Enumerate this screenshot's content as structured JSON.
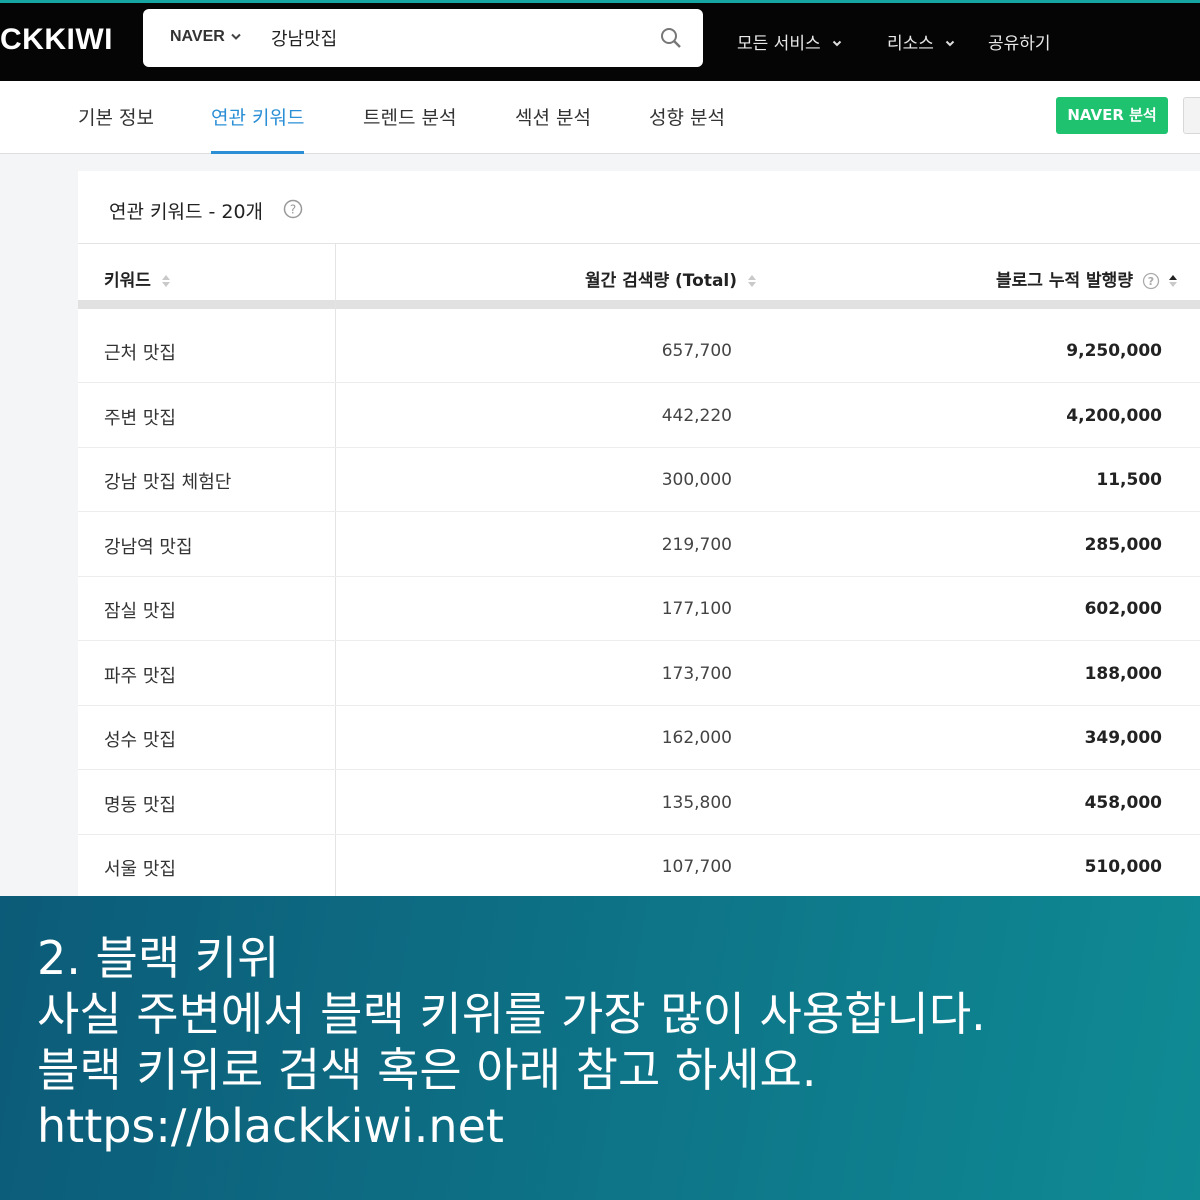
{
  "header": {
    "logo": "CKKIWI",
    "engine": "NAVER",
    "search_value": "강남맛집",
    "nav": [
      "모든 서비스",
      "리소스",
      "공유하기"
    ]
  },
  "tabs": [
    "기본 정보",
    "연관 키워드",
    "트렌드 분석",
    "섹션 분석",
    "성향 분석"
  ],
  "active_tab": "연관 키워드",
  "naver_button": "NAVER 분석",
  "panel": {
    "title": "연관 키워드 - 20개",
    "columns": [
      "키워드",
      "월간 검색량 (Total)",
      "블로그 누적 발행량"
    ],
    "rows": [
      {
        "keyword": "근처 맛집",
        "volume": "657,700",
        "blog": "9,250,000"
      },
      {
        "keyword": "주변 맛집",
        "volume": "442,220",
        "blog": "4,200,000"
      },
      {
        "keyword": "강남 맛집 체험단",
        "volume": "300,000",
        "blog": "11,500"
      },
      {
        "keyword": "강남역 맛집",
        "volume": "219,700",
        "blog": "285,000"
      },
      {
        "keyword": "잠실 맛집",
        "volume": "177,100",
        "blog": "602,000"
      },
      {
        "keyword": "파주 맛집",
        "volume": "173,700",
        "blog": "188,000"
      },
      {
        "keyword": "성수 맛집",
        "volume": "162,000",
        "blog": "349,000"
      },
      {
        "keyword": "명동 맛집",
        "volume": "135,800",
        "blog": "458,000"
      },
      {
        "keyword": "서울 맛집",
        "volume": "107,700",
        "blog": "510,000"
      }
    ]
  },
  "caption": {
    "line1": "2. 블랙 키위",
    "line2": "사실 주변에서 블랙 키위를 가장 많이 사용합니다.",
    "line3": "블랙 키위로 검색 혹은 아래 참고 하세요.",
    "line4": "https://blackkiwi.net"
  },
  "colors": {
    "accent": "#2b8fd6",
    "naver_green": "#1ec26f",
    "topbar": "#050505",
    "overlay": "#0e7c8c"
  },
  "icons": {
    "search": "magnifier-icon",
    "help": "question-circle-icon",
    "sort": "sort-arrows-icon",
    "dropdown": "chevron-down-icon"
  }
}
